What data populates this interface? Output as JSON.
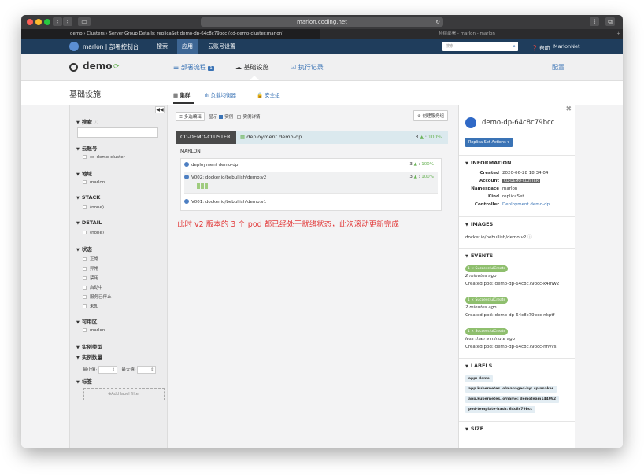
{
  "browser": {
    "url": "marlon.coding.net",
    "tabs": [
      "demo › Clusters › Server Group Details: replicaSet demo-dp-64c8c79bcc (cd-demo-cluster:marlon)",
      "持续部署 - marlon - marlon"
    ]
  },
  "topnav": {
    "brand": "marlon | 部署控制台",
    "items": [
      "搜索",
      "应用",
      "云账号设置"
    ],
    "active_item": "应用",
    "search_placeholder": "搜索",
    "help": "帮助",
    "user": "MarlonNet"
  },
  "app": {
    "name": "demo",
    "tabs": [
      {
        "label": "部署流程",
        "badge": "1"
      },
      {
        "label": "基础设施"
      },
      {
        "label": "执行记录"
      }
    ],
    "active_tab": "基础设施",
    "config": "配置"
  },
  "section": {
    "title": "基础设施",
    "subtabs": [
      "集群",
      "负载均衡器",
      "安全组"
    ],
    "active_subtab": "集群"
  },
  "sidebar": {
    "search_label": "搜索",
    "groups": [
      {
        "label": "云账号",
        "options": [
          "cd-demo-cluster"
        ]
      },
      {
        "label": "地域",
        "options": [
          "marlon"
        ]
      },
      {
        "label": "STACK",
        "options": [
          "(none)"
        ]
      },
      {
        "label": "DETAIL",
        "options": [
          "(none)"
        ]
      },
      {
        "label": "状态",
        "options": [
          "正常",
          "异常",
          "禁用",
          "启动中",
          "服务已停止",
          "未知"
        ]
      },
      {
        "label": "可用区",
        "options": [
          "marlon"
        ]
      },
      {
        "label": "实例类型",
        "options": []
      },
      {
        "label": "实例数量",
        "options": []
      },
      {
        "label": "标签",
        "options": []
      }
    ],
    "min_label": "最小值:",
    "max_label": "最大值:",
    "add_label_filter": "Add label filter"
  },
  "toolbar": {
    "multi_edit": "多选编辑",
    "display": "显示",
    "instances": "实例",
    "instance_details": "实例详情",
    "create_group": "创建服务组"
  },
  "cluster": {
    "name": "CD-DEMO-CLUSTER",
    "deployment": "deployment demo-dp",
    "count": "3",
    "percent": "100%",
    "region": "MARLON",
    "server_groups": [
      {
        "label": "deployment demo-dp",
        "count": "3",
        "percent": "100%"
      },
      {
        "label": "V002: docker.io/bebullish/demo:v2",
        "count": "3",
        "percent": "100%",
        "pods": 3
      },
      {
        "label": "V001: docker.io/bebullish/demo:v1",
        "count": "",
        "percent": ""
      }
    ]
  },
  "annotation": "此时 v2 版本的 3 个 pod 都已经处于就绪状态，此次滚动更新完成",
  "detail": {
    "title": "demo-dp-64c8c79bcc",
    "actions_button": "Replica Set Actions",
    "information_title": "INFORMATION",
    "info": [
      {
        "key": "Created",
        "value": "2020-06-28 18:34:04"
      },
      {
        "key": "Account",
        "value": "CD-DEMO-CLUSTER"
      },
      {
        "key": "Namespace",
        "value": "marlon"
      },
      {
        "key": "Kind",
        "value": "replicaSet"
      },
      {
        "key": "Controller",
        "value": "Deployment demo-dp"
      }
    ],
    "images_title": "IMAGES",
    "image": "docker.io/bebullish/demo:v2",
    "events_title": "EVENTS",
    "events": [
      {
        "badge": "1 × SuccessfulCreate",
        "time": "2 minutes ago",
        "message": "Created pod: demo-dp-64c8c79bcc-k4mw2"
      },
      {
        "badge": "1 × SuccessfulCreate",
        "time": "2 minutes ago",
        "message": "Created pod: demo-dp-64c8c79bcc-nkptf"
      },
      {
        "badge": "1 × SuccessfulCreate",
        "time": "less than a minute ago",
        "message": "Created pod: demo-dp-64c8c79bcc-nhvvs"
      }
    ],
    "labels_title": "LABELS",
    "labels": [
      "app: demo",
      "app.kubernetes.io/managed-by: spinnaker",
      "app.kubernetes.io/name: demoteam144092",
      "pod-template-hash: 64c8c79bcc"
    ],
    "size_title": "SIZE"
  }
}
